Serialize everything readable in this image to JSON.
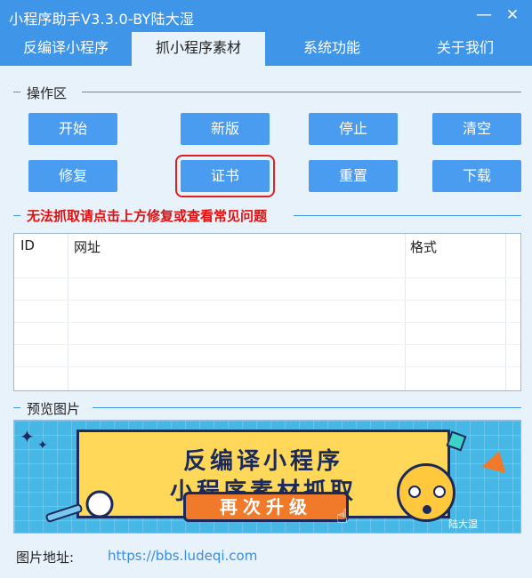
{
  "window": {
    "title": "小程序助手V3.3.0-BY陆大湿"
  },
  "tabs": [
    {
      "label": "反编译小程序"
    },
    {
      "label": "抓小程序素材"
    },
    {
      "label": "系统功能"
    },
    {
      "label": "关于我们"
    }
  ],
  "ops": {
    "group_label": "操作区",
    "buttons": {
      "start": "开始",
      "new_version": "新版",
      "stop": "停止",
      "clear": "清空",
      "repair": "修复",
      "certificate": "证书",
      "reset": "重置",
      "download": "下载"
    }
  },
  "warning": "无法抓取请点击上方修复或查看常见问题",
  "table": {
    "columns": [
      "ID",
      "网址",
      "格式"
    ],
    "rows": []
  },
  "preview": {
    "group_label": "预览图片",
    "banner": {
      "line1": "反编译小程序",
      "line2": "小程序素材抓取",
      "pill": "再次升级",
      "watermark": "陆大湿"
    }
  },
  "address": {
    "label": "图片地址:",
    "url": "https://bbs.ludeqi.com"
  },
  "colors": {
    "titlebar": "#3f95e8",
    "button": "#4a9cf0",
    "warning": "#e01010",
    "link": "#3a8de0",
    "background": "#e8f2fb"
  }
}
